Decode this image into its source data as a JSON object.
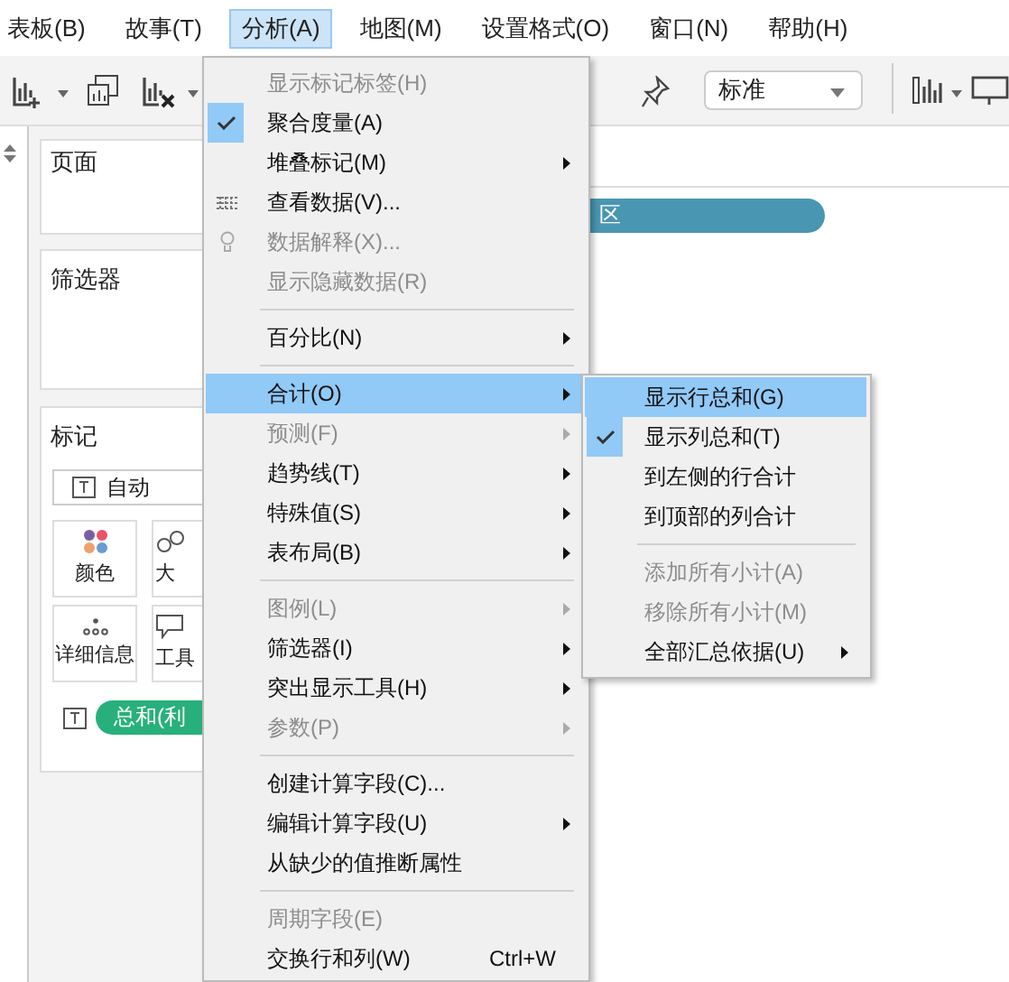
{
  "menubar": [
    {
      "label": "表板(B)",
      "selected": false
    },
    {
      "label": "故事(T)",
      "selected": false
    },
    {
      "label": "分析(A)",
      "selected": true
    },
    {
      "label": "地图(M)",
      "selected": false
    },
    {
      "label": "设置格式(O)",
      "selected": false
    },
    {
      "label": "窗口(N)",
      "selected": false
    },
    {
      "label": "帮助(H)",
      "selected": false
    }
  ],
  "toolbar": {
    "fit_dropdown": "标准"
  },
  "pages_card": {
    "title": "页面"
  },
  "filters_card": {
    "title": "筛选器"
  },
  "marks_card": {
    "title": "标记",
    "mark_type": "自动",
    "tiles": [
      {
        "label": "颜色"
      },
      {
        "label": "大"
      },
      {
        "label": "详细信息"
      },
      {
        "label": "工具"
      }
    ],
    "pill": "总和(利"
  },
  "rows_pill": "区",
  "analysis_menu": [
    {
      "kind": "item",
      "label": "显示标记标签(H)",
      "disabled": true,
      "checked": false,
      "submenu": false,
      "selected": false
    },
    {
      "kind": "item",
      "label": "聚合度量(A)",
      "disabled": false,
      "checked": true,
      "submenu": false,
      "selected": false
    },
    {
      "kind": "item",
      "label": "堆叠标记(M)",
      "disabled": false,
      "checked": false,
      "submenu": true,
      "selected": false
    },
    {
      "kind": "data-item",
      "label": "查看数据(V)...",
      "disabled": false,
      "checked": false,
      "submenu": false,
      "selected": false
    },
    {
      "kind": "hint-item",
      "label": "数据解释(X)...",
      "disabled": true,
      "checked": false,
      "submenu": false,
      "selected": false
    },
    {
      "kind": "item",
      "label": "显示隐藏数据(R)",
      "disabled": true,
      "checked": false,
      "submenu": false,
      "selected": false
    },
    {
      "kind": "separator"
    },
    {
      "kind": "item",
      "label": "百分比(N)",
      "disabled": false,
      "checked": false,
      "submenu": true,
      "selected": false
    },
    {
      "kind": "separator"
    },
    {
      "kind": "item",
      "label": "合计(O)",
      "disabled": false,
      "checked": false,
      "submenu": true,
      "selected": true
    },
    {
      "kind": "item",
      "label": "预测(F)",
      "disabled": true,
      "checked": false,
      "submenu": true,
      "selected": false
    },
    {
      "kind": "item",
      "label": "趋势线(T)",
      "disabled": false,
      "checked": false,
      "submenu": true,
      "selected": false
    },
    {
      "kind": "item",
      "label": "特殊值(S)",
      "disabled": false,
      "checked": false,
      "submenu": true,
      "selected": false
    },
    {
      "kind": "item",
      "label": "表布局(B)",
      "disabled": false,
      "checked": false,
      "submenu": true,
      "selected": false
    },
    {
      "kind": "separator"
    },
    {
      "kind": "item",
      "label": "图例(L)",
      "disabled": true,
      "checked": false,
      "submenu": true,
      "selected": false
    },
    {
      "kind": "item",
      "label": "筛选器(I)",
      "disabled": false,
      "checked": false,
      "submenu": true,
      "selected": false
    },
    {
      "kind": "item",
      "label": "突出显示工具(H)",
      "disabled": false,
      "checked": false,
      "submenu": true,
      "selected": false
    },
    {
      "kind": "item",
      "label": "参数(P)",
      "disabled": true,
      "checked": false,
      "submenu": true,
      "selected": false
    },
    {
      "kind": "separator"
    },
    {
      "kind": "item",
      "label": "创建计算字段(C)...",
      "disabled": false,
      "checked": false,
      "submenu": false,
      "selected": false
    },
    {
      "kind": "item",
      "label": "编辑计算字段(U)",
      "disabled": false,
      "checked": false,
      "submenu": true,
      "selected": false
    },
    {
      "kind": "item",
      "label": "从缺少的值推断属性",
      "disabled": false,
      "checked": false,
      "submenu": false,
      "selected": false
    },
    {
      "kind": "separator"
    },
    {
      "kind": "item",
      "label": "周期字段(E)",
      "disabled": true,
      "checked": false,
      "submenu": false,
      "selected": false
    },
    {
      "kind": "item",
      "label": "交换行和列(W)",
      "shortcut": "Ctrl+W",
      "disabled": false,
      "checked": false,
      "submenu": false,
      "selected": false
    }
  ],
  "totals_submenu": [
    {
      "kind": "item",
      "label": "显示行总和(G)",
      "disabled": false,
      "checked": false,
      "submenu": false,
      "selected": true
    },
    {
      "kind": "item",
      "label": "显示列总和(T)",
      "disabled": false,
      "checked": true,
      "submenu": false,
      "selected": false
    },
    {
      "kind": "item",
      "label": "到左侧的行合计",
      "disabled": false,
      "checked": false,
      "submenu": false,
      "selected": false
    },
    {
      "kind": "item",
      "label": "到顶部的列合计",
      "disabled": false,
      "checked": false,
      "submenu": false,
      "selected": false
    },
    {
      "kind": "separator"
    },
    {
      "kind": "item",
      "label": "添加所有小计(A)",
      "disabled": true,
      "checked": false,
      "submenu": false,
      "selected": false
    },
    {
      "kind": "item",
      "label": "移除所有小计(M)",
      "disabled": true,
      "checked": false,
      "submenu": false,
      "selected": false
    },
    {
      "kind": "item",
      "label": "全部汇总依据(U)",
      "disabled": false,
      "checked": false,
      "submenu": true,
      "selected": false
    }
  ]
}
